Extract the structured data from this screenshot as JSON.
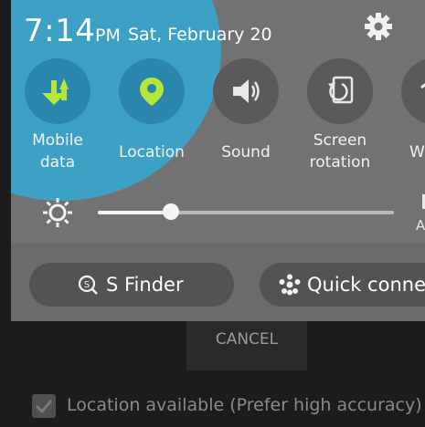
{
  "status": {
    "time": "7:14",
    "ampm": "PM",
    "date": "Sat, February 20"
  },
  "quick_settings": [
    {
      "label_line1": "Mobile",
      "label_line2": "data",
      "icon": "mobile-data-icon",
      "active": true
    },
    {
      "label_line1": "Location",
      "label_line2": "",
      "icon": "location-pin-icon",
      "active": true
    },
    {
      "label_line1": "Sound",
      "label_line2": "",
      "icon": "speaker-icon",
      "active": false
    },
    {
      "label_line1": "Screen",
      "label_line2": "rotation",
      "icon": "rotation-icon",
      "active": false
    },
    {
      "label_line1": "W",
      "label_line2": "",
      "icon": "wifi-icon",
      "active": false
    }
  ],
  "brightness": {
    "level": 0.25,
    "auto_label": "A"
  },
  "pills": {
    "s_finder": "S Finder",
    "quick_connect": "Quick conne"
  },
  "background": {
    "cancel": "CANCEL",
    "checkbox_label": "Location available (Prefer high accuracy)"
  },
  "colors": {
    "accent": "#3aa3c9",
    "icon_active": "#b6e63a"
  }
}
